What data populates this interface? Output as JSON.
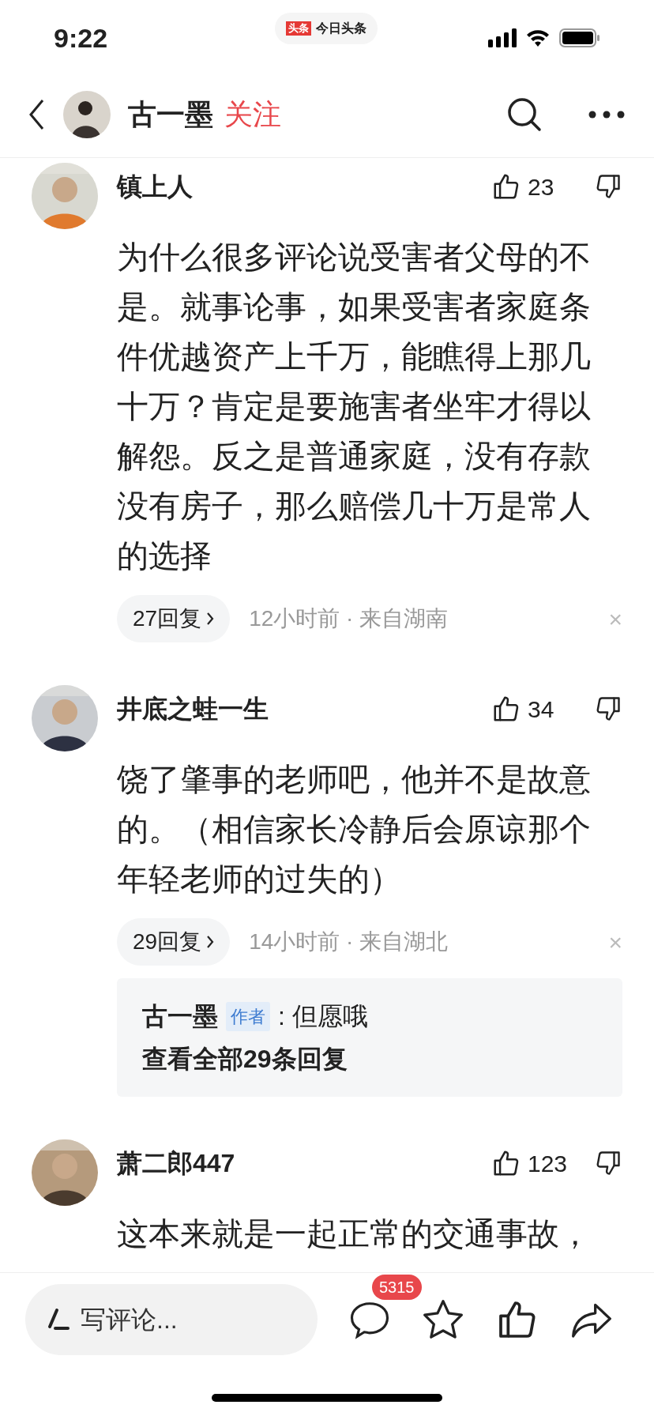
{
  "status_bar": {
    "time": "9:22",
    "app_badge": "头条",
    "app_name": "今日头条"
  },
  "nav": {
    "author": "古一墨",
    "follow": "关注"
  },
  "comments": [
    {
      "user": "镇上人",
      "likes": "23",
      "text": "为什么很多评论说受害者父母的不是。就事论事，如果受害者家庭条件优越资产上千万，能瞧得上那几十万？肯定是要施害者坐牢才得以解怨。反之是普通家庭，没有存款没有房子，那么赔偿几十万是常人的选择",
      "replies": "27回复",
      "meta": "12小时前 · 来自湖南",
      "close": "×"
    },
    {
      "user": "井底之蛙一生",
      "likes": "34",
      "text": "饶了肇事的老师吧，他并不是故意的。（相信家长冷静后会原谅那个年轻老师的过失的）",
      "replies": "29回复",
      "meta": "14小时前 · 来自湖北",
      "close": "×",
      "sub_reply": {
        "user": "古一墨",
        "tag": "作者",
        "text": ": 但愿哦",
        "more": "查看全部29条回复"
      }
    },
    {
      "user": "萧二郎447",
      "likes": "123",
      "text": "这本来就是一起正常的交通事故，"
    }
  ],
  "bottom_bar": {
    "placeholder": "写评论...",
    "comment_count": "5315"
  }
}
